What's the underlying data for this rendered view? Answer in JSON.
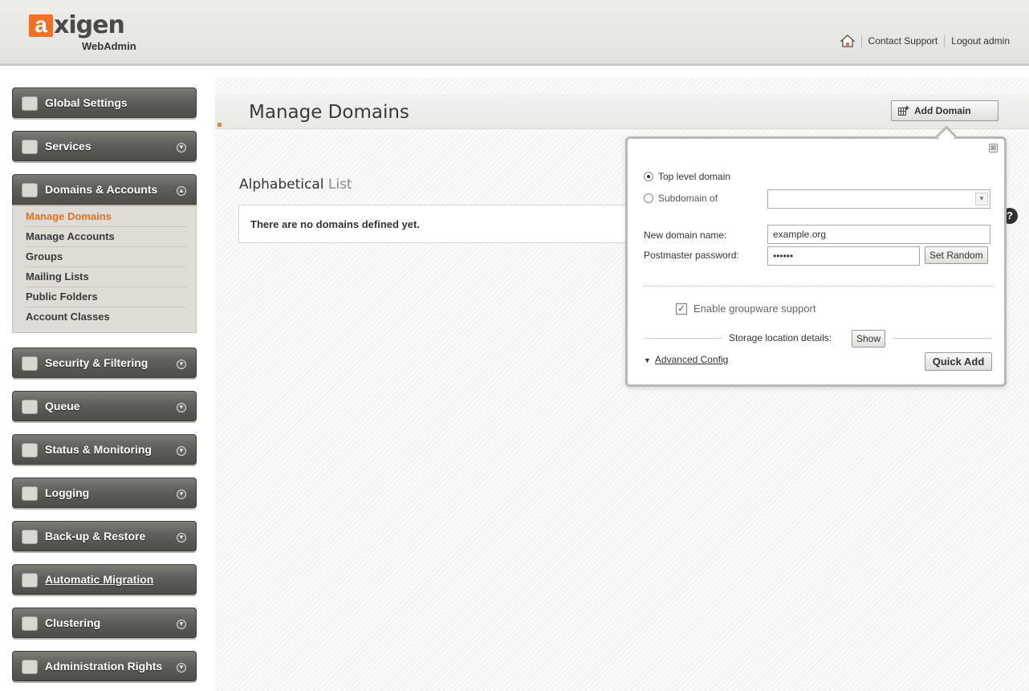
{
  "header": {
    "logo_letter": "a",
    "logo_text": "xigen",
    "logo_sub": "WebAdmin",
    "contact_support": "Contact Support",
    "logout": "Logout admin"
  },
  "sidebar": {
    "items": [
      {
        "label": "Global Settings",
        "icon": "globe-settings-icon",
        "expandable": false
      },
      {
        "label": "Services",
        "icon": "services-icon",
        "expandable": true
      },
      {
        "label": "Domains & Accounts",
        "icon": "domains-icon",
        "expandable": true,
        "open": true
      },
      {
        "label": "Security & Filtering",
        "icon": "security-icon",
        "expandable": true
      },
      {
        "label": "Queue",
        "icon": "queue-icon",
        "expandable": true
      },
      {
        "label": "Status & Monitoring",
        "icon": "monitoring-icon",
        "expandable": true
      },
      {
        "label": "Logging",
        "icon": "logging-icon",
        "expandable": true
      },
      {
        "label": "Back-up & Restore",
        "icon": "backup-icon",
        "expandable": true
      },
      {
        "label": "Automatic Migration",
        "icon": "migration-icon",
        "expandable": false
      },
      {
        "label": "Clustering",
        "icon": "clustering-icon",
        "expandable": true
      },
      {
        "label": "Administration Rights",
        "icon": "admin-rights-icon",
        "expandable": true
      }
    ],
    "submenu": [
      {
        "label": "Manage Domains",
        "active": true
      },
      {
        "label": "Manage Accounts"
      },
      {
        "label": "Groups"
      },
      {
        "label": "Mailing Lists"
      },
      {
        "label": "Public Folders"
      },
      {
        "label": "Account Classes"
      }
    ]
  },
  "main": {
    "title": "Manage Domains",
    "add_domain_label": "Add Domain",
    "section_title_bold": "Alphabetical",
    "section_title_light": "List",
    "empty_message": "There are no domains defined yet.",
    "help": "?"
  },
  "popup": {
    "close": "⊠",
    "top_level_label": "Top level domain",
    "subdomain_label": "Subdomain of",
    "subdomain_value": "",
    "new_domain_label": "New domain name:",
    "new_domain_value": "example.org",
    "postmaster_label": "Postmaster password:",
    "postmaster_value": "••••••",
    "set_random_label": "Set Random",
    "groupware_label": "Enable groupware support",
    "groupware_checked": true,
    "storage_label": "Storage location details:",
    "show_label": "Show",
    "advanced_label": "Advanced Config",
    "quick_add_label": "Quick Add"
  },
  "colors": {
    "accent": "#f37021",
    "active_menu": "#e8701c",
    "nav_bg": "#5f5e58"
  }
}
